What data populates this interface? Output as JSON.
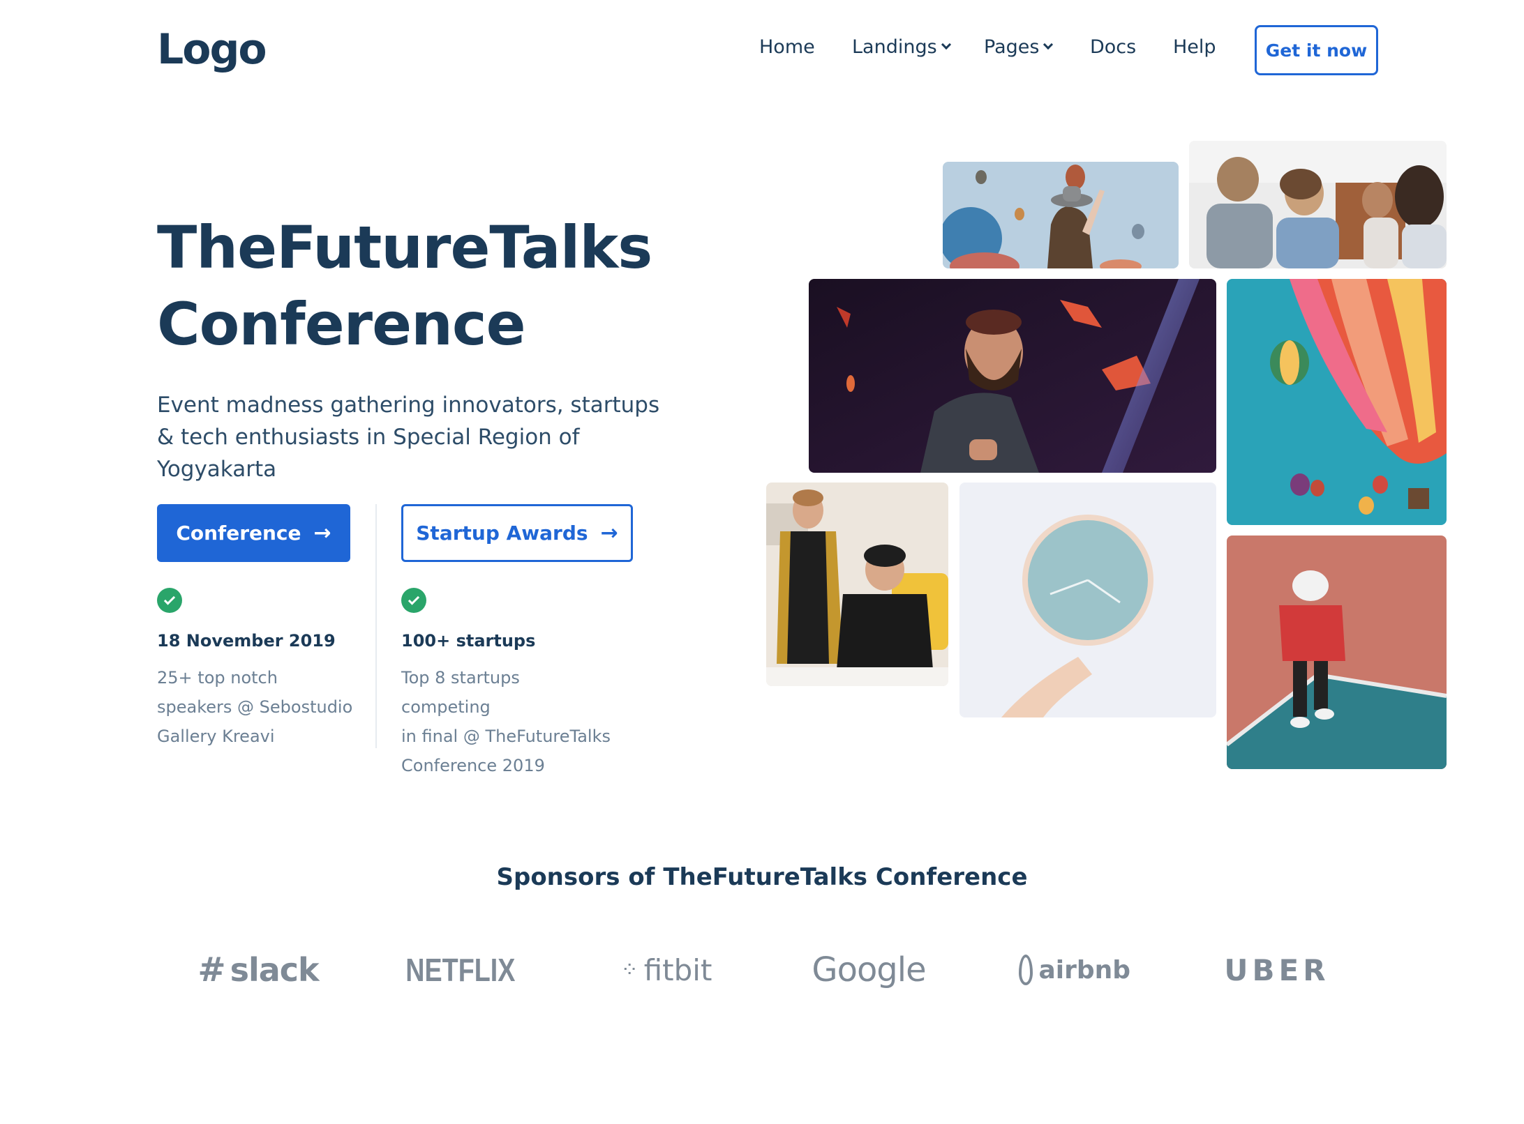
{
  "nav": {
    "logo": "Logo",
    "items": [
      {
        "label": "Home",
        "has_dropdown": false
      },
      {
        "label": "Landings",
        "has_dropdown": true
      },
      {
        "label": "Pages",
        "has_dropdown": true
      },
      {
        "label": "Docs",
        "has_dropdown": false
      },
      {
        "label": "Help",
        "has_dropdown": false
      }
    ],
    "cta_label": "Get it now"
  },
  "hero": {
    "title_line1": "TheFutureTalks",
    "title_line2": "Conference",
    "subtitle_line1": "Event madness gathering innovators, startups",
    "subtitle_line2": "& tech enthusiasts in Special Region of Yogyakarta",
    "primary_button": "Conference",
    "secondary_button": "Startup Awards"
  },
  "features": [
    {
      "title": "18 November 2019",
      "desc_lines": [
        "25+ top notch",
        "speakers @ Sebostudio",
        "Gallery Kreavi"
      ]
    },
    {
      "title": "100+ startups",
      "desc_lines": [
        "Top 8 startups competing",
        "in final @ TheFutureTalks",
        "Conference 2019"
      ]
    }
  ],
  "sponsors": {
    "title": "Sponsors of TheFutureTalks Conference",
    "logos": [
      "slack",
      "NETFLIX",
      "fitbit",
      "Google",
      "airbnb",
      "UBER"
    ]
  },
  "colors": {
    "accent": "#1f66d6",
    "heading": "#1b3a57",
    "success": "#2aa56a",
    "muted": "#6b7f93",
    "logo_gray": "#7f8a96"
  }
}
